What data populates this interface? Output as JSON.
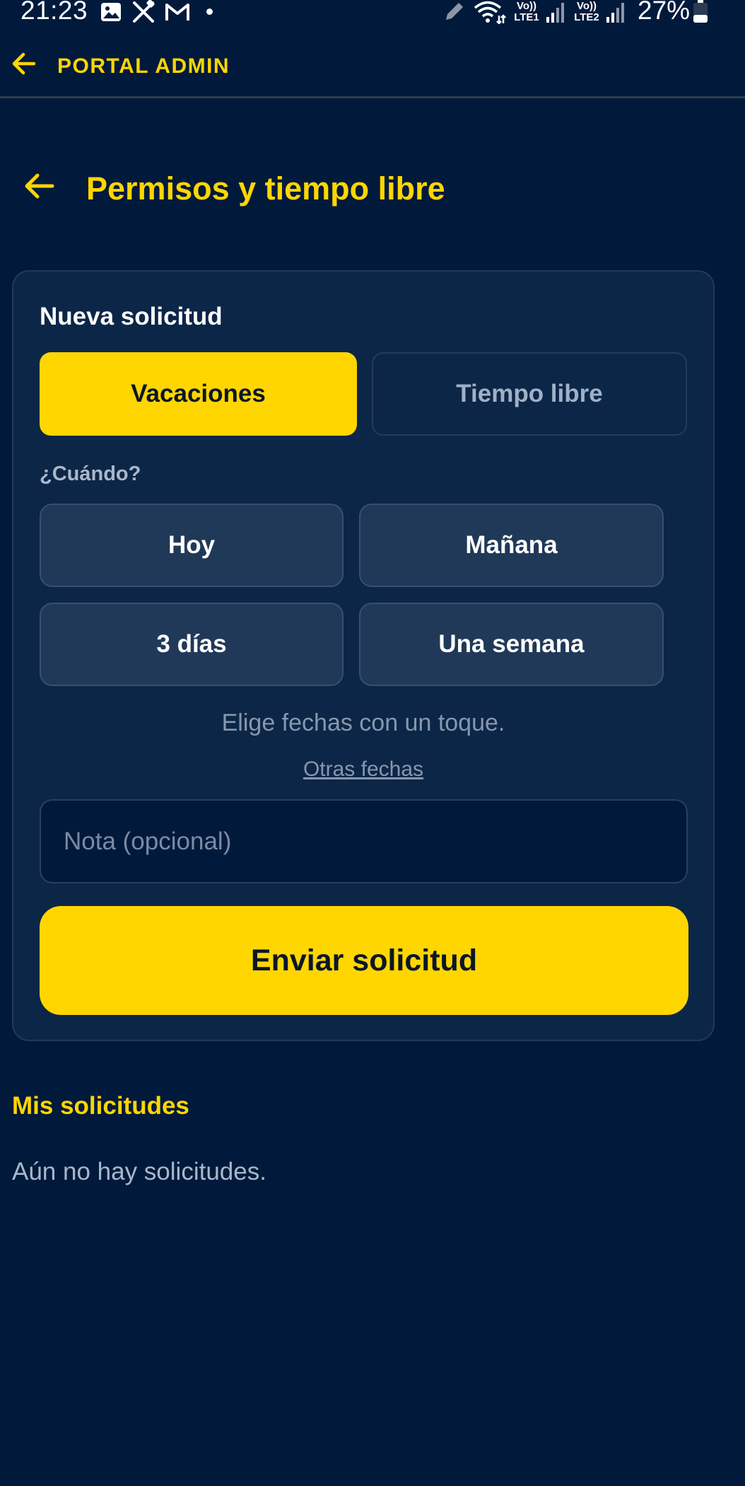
{
  "status_bar": {
    "time": "21:23",
    "notification_icons": [
      "image-icon",
      "tools-icon",
      "gmail-icon",
      "dot-icon"
    ],
    "network": [
      {
        "label_top": "Vo))",
        "label_bottom": "LTE1"
      },
      {
        "label_top": "Vo))",
        "label_bottom": "LTE2"
      }
    ],
    "battery": "27%"
  },
  "app_bar": {
    "title": "PORTAL ADMIN",
    "back_icon": "arrow-left-icon",
    "accent_color": "#ffd600"
  },
  "page": {
    "title": "Permisos y tiempo libre",
    "back_icon": "arrow-left-icon"
  },
  "new_request": {
    "title": "Nueva solicitud",
    "types": [
      {
        "label": "Vacaciones",
        "selected": true
      },
      {
        "label": "Tiempo libre",
        "selected": false
      }
    ],
    "when_label": "¿Cuándo?",
    "quick_options": [
      "Hoy",
      "Mañana",
      "3 días",
      "Una semana"
    ],
    "hint": "Elige fechas con un toque.",
    "other_dates": "Otras fechas",
    "note_placeholder": "Nota (opcional)",
    "note_value": "",
    "submit_label": "Enviar solicitud"
  },
  "my_requests": {
    "title": "Mis solicitudes",
    "empty_text": "Aún no hay solicitudes."
  },
  "colors": {
    "background": "#011a3c",
    "card": "#0c2647",
    "accent": "#ffd600",
    "chip": "#203958"
  }
}
